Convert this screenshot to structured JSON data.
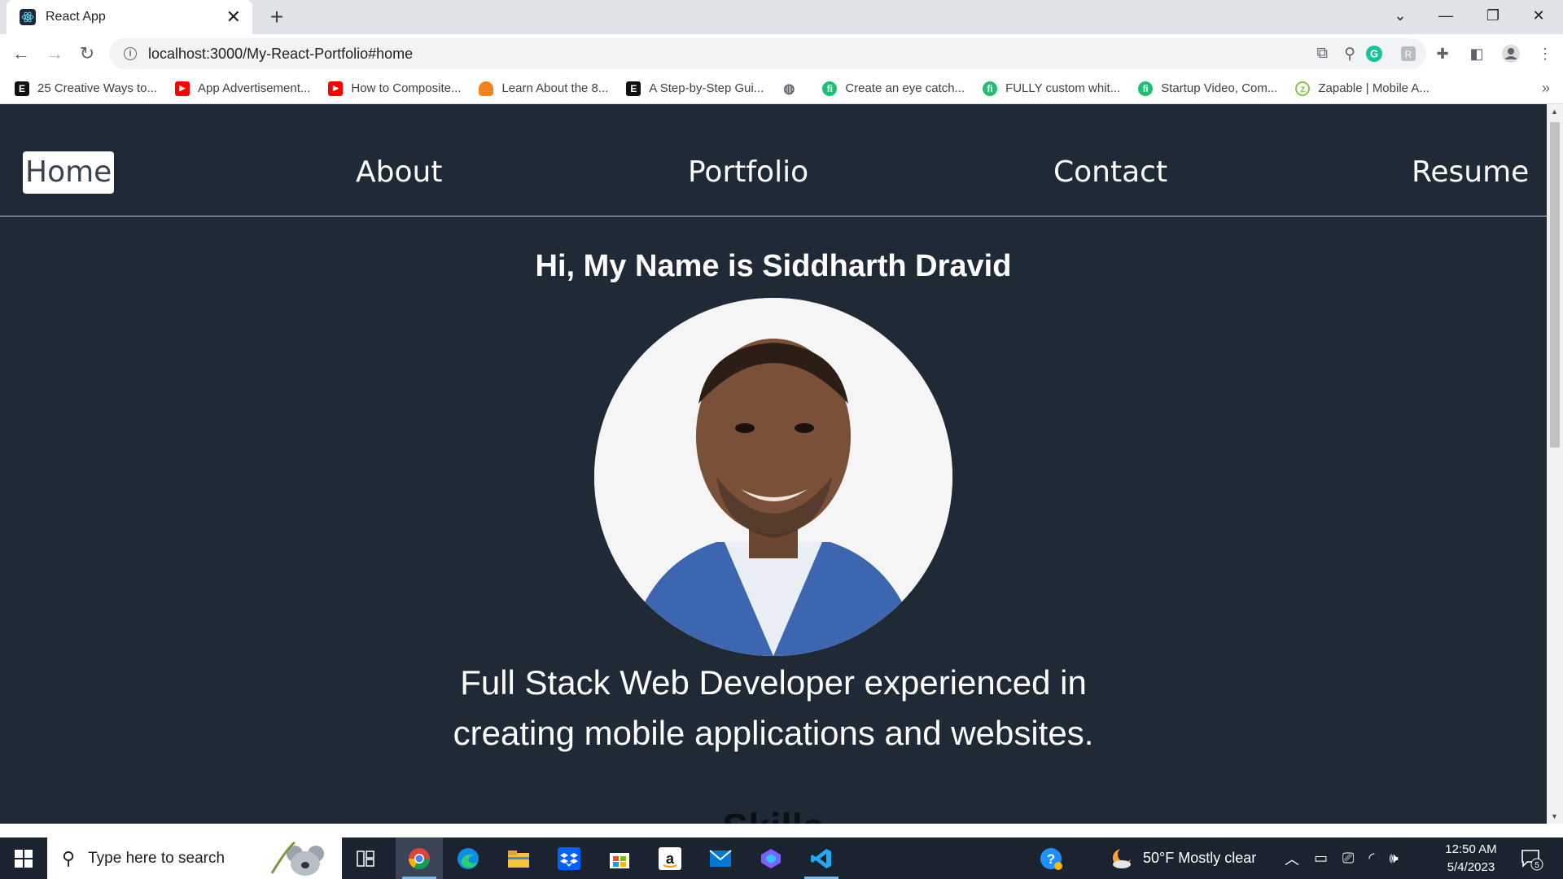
{
  "browser": {
    "tab_title": "React App",
    "url": "localhost:3000/My-React-Portfolio#home",
    "bookmarks": [
      {
        "label": "25 Creative Ways to...",
        "icon": "E",
        "color": "#111111"
      },
      {
        "label": "App Advertisement...",
        "icon": "yt",
        "color": "#ff0000"
      },
      {
        "label": "How to Composite...",
        "icon": "yt",
        "color": "#ff0000"
      },
      {
        "label": "Learn About the 8...",
        "icon": "cloud",
        "color": "#f48120"
      },
      {
        "label": "A Step-by-Step Gui...",
        "icon": "E",
        "color": "#111111"
      },
      {
        "label": "",
        "icon": "globe",
        "color": "#5f6368"
      },
      {
        "label": "Create an eye catch...",
        "icon": "fi",
        "color": "#1dbf73"
      },
      {
        "label": "FULLY custom whit...",
        "icon": "fi",
        "color": "#1dbf73"
      },
      {
        "label": "Startup Video, Com...",
        "icon": "fi",
        "color": "#1dbf73"
      },
      {
        "label": "Zapable | Mobile A...",
        "icon": "z",
        "color": "#8bc34a"
      }
    ],
    "more_bookmarks": "»"
  },
  "site": {
    "nav": [
      "Home",
      "About",
      "Portfolio",
      "Contact",
      "Resume"
    ],
    "active_nav": "Home",
    "greeting": "Hi, My Name is Siddharth Dravid",
    "tagline": "Full Stack Web Developer experienced in creating mobile applications and websites.",
    "next_heading": "Skills"
  },
  "taskbar": {
    "search_placeholder": "Type here to search",
    "weather": "50°F  Mostly clear",
    "time": "12:50 AM",
    "date": "5/4/2023",
    "notifications": "5"
  },
  "colors": {
    "page_bg": "#202936",
    "accent": "#ffffff"
  }
}
